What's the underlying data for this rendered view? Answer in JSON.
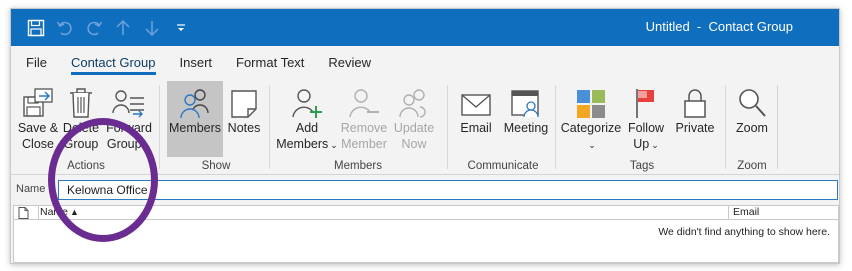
{
  "window": {
    "title": "Untitled  -  Contact Group"
  },
  "quick_access": {
    "icons": [
      "save-icon",
      "undo-icon",
      "redo-icon",
      "arrow-up-icon",
      "arrow-down-icon",
      "customize-qat-icon"
    ]
  },
  "tabs": [
    {
      "label": "File",
      "active": false
    },
    {
      "label": "Contact Group",
      "active": true
    },
    {
      "label": "Insert",
      "active": false
    },
    {
      "label": "Format Text",
      "active": false
    },
    {
      "label": "Review",
      "active": false
    }
  ],
  "ribbon": {
    "actions": {
      "label": "Actions",
      "save_close": {
        "line1": "Save &",
        "line2": "Close"
      },
      "delete_group": {
        "line1": "Delete",
        "line2": "Group"
      },
      "forward_group": {
        "line1": "Forward",
        "line2": "Group"
      }
    },
    "show": {
      "label": "Show",
      "members": "Members",
      "notes": "Notes"
    },
    "members": {
      "label": "Members",
      "add": {
        "line1": "Add",
        "line2": "Members"
      },
      "remove": {
        "line1": "Remove",
        "line2": "Member"
      },
      "update": {
        "line1": "Update",
        "line2": "Now"
      }
    },
    "communicate": {
      "label": "Communicate",
      "email": "Email",
      "meeting": "Meeting"
    },
    "tags": {
      "label": "Tags",
      "categorize": "Categorize",
      "follow_up": {
        "line1": "Follow",
        "line2": "Up"
      },
      "private": "Private"
    },
    "zoom": {
      "label": "Zoom",
      "zoom": "Zoom"
    }
  },
  "name_field": {
    "label": "Name",
    "value": "Kelowna Office"
  },
  "members_list": {
    "columns": [
      "Name",
      "Email"
    ],
    "empty_message": "We didn't find anything to show here."
  },
  "colors": {
    "titlebar": "#106ebe",
    "annotation": "#6a2c91",
    "ribbon_bg": "#f3f3f3"
  }
}
